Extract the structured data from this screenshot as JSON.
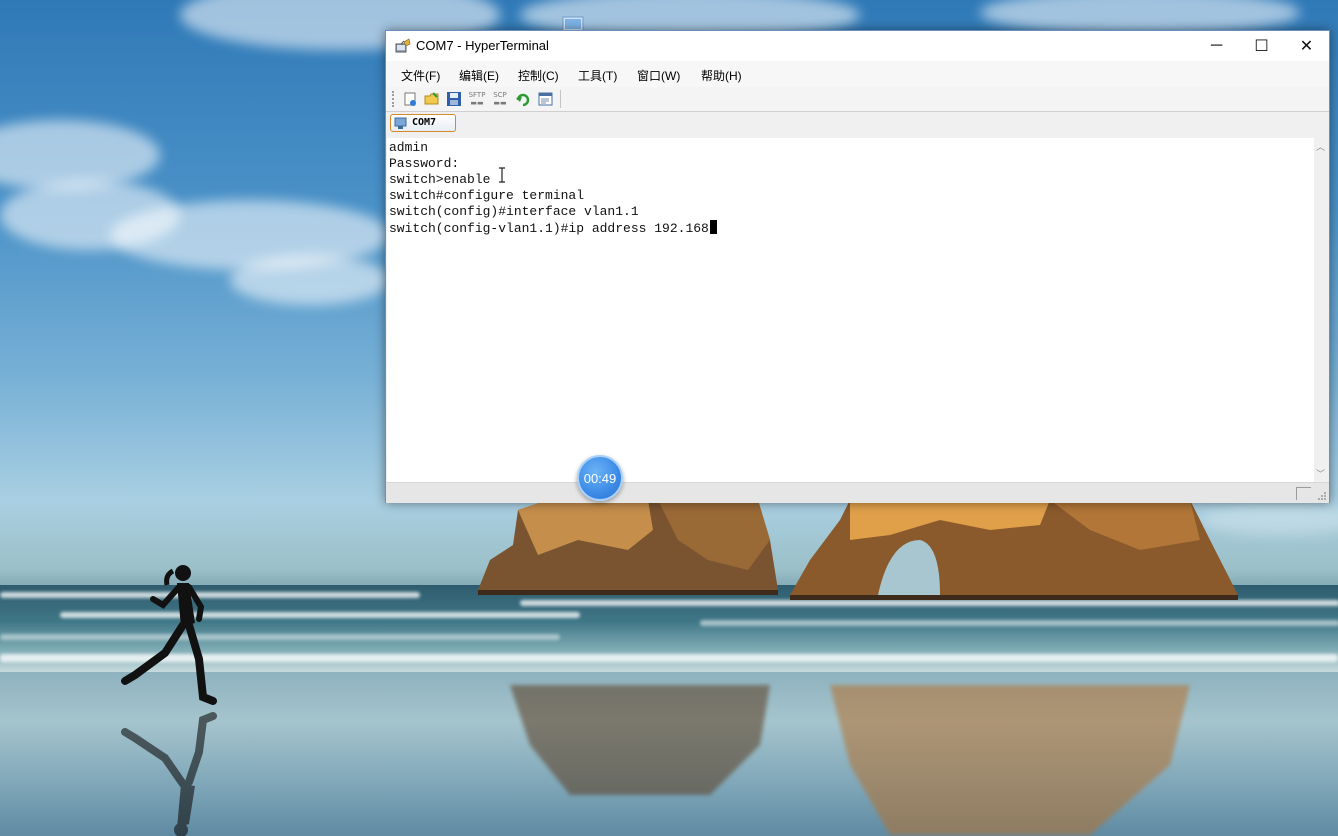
{
  "window": {
    "title": "COM7 - HyperTerminal",
    "controls": {
      "minimize": "─",
      "maximize": "☐",
      "close": "✕"
    }
  },
  "menu": {
    "items": [
      {
        "label": "文件(F)"
      },
      {
        "label": "编辑(E)"
      },
      {
        "label": "控制(C)"
      },
      {
        "label": "工具(T)"
      },
      {
        "label": "窗口(W)"
      },
      {
        "label": "帮助(H)"
      }
    ]
  },
  "toolbar": {
    "sftp_label": "SFTP",
    "scp_label": "SCP"
  },
  "tabs": [
    {
      "label": "COM7",
      "active": true
    }
  ],
  "terminal": {
    "lines": [
      "admin",
      "Password:",
      "switch>enable",
      "switch#configure terminal",
      "switch(config)#interface vlan1.1",
      "switch(config-vlan1.1)#ip address 192.168"
    ]
  },
  "overlay": {
    "timer": "00:49"
  },
  "colors": {
    "tab_border": "#d48a28",
    "timer_badge": "#3b8ae6",
    "terminal_bg": "#ffffff",
    "terminal_text": "#111111"
  }
}
